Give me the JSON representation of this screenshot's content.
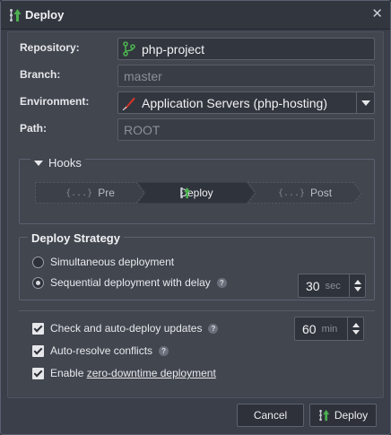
{
  "window": {
    "title": "Deploy",
    "close_icon": "close-icon"
  },
  "form": {
    "repository": {
      "label": "Repository:",
      "value": "php-project",
      "icon": "git-branch-icon",
      "icon_color": "#4caf50"
    },
    "branch": {
      "label": "Branch:",
      "value": "master"
    },
    "environment": {
      "label": "Environment:",
      "value": "Application Servers (php-hosting)",
      "icon": "feather-icon",
      "icon_color": "#d9342b"
    },
    "path": {
      "label": "Path:",
      "value": "ROOT"
    }
  },
  "hooks": {
    "title": "Hooks",
    "steps": [
      {
        "label": "Pre",
        "icon": "braces-icon",
        "active": false
      },
      {
        "label": "Deploy",
        "icon": "deploy-icon",
        "active": true
      },
      {
        "label": "Post",
        "icon": "braces-icon",
        "active": false
      }
    ]
  },
  "strategy": {
    "title": "Deploy Strategy",
    "options": [
      {
        "label": "Simultaneous deployment",
        "selected": false
      },
      {
        "label": "Sequential deployment with delay",
        "selected": true
      }
    ],
    "delay": {
      "value": "30",
      "unit": "sec"
    }
  },
  "options": {
    "auto_deploy": {
      "label": "Check and auto-deploy updates",
      "checked": true,
      "interval": {
        "value": "60",
        "unit": "min"
      }
    },
    "auto_resolve": {
      "label": "Auto-resolve conflicts",
      "checked": true
    },
    "zero_downtime": {
      "prefix": "Enable ",
      "link": "zero-downtime deployment",
      "checked": true
    }
  },
  "footer": {
    "cancel_label": "Cancel",
    "deploy_label": "Deploy"
  },
  "colors": {
    "accent_green": "#4caf50",
    "panel": "#41464f",
    "titlebar": "#32363f"
  }
}
